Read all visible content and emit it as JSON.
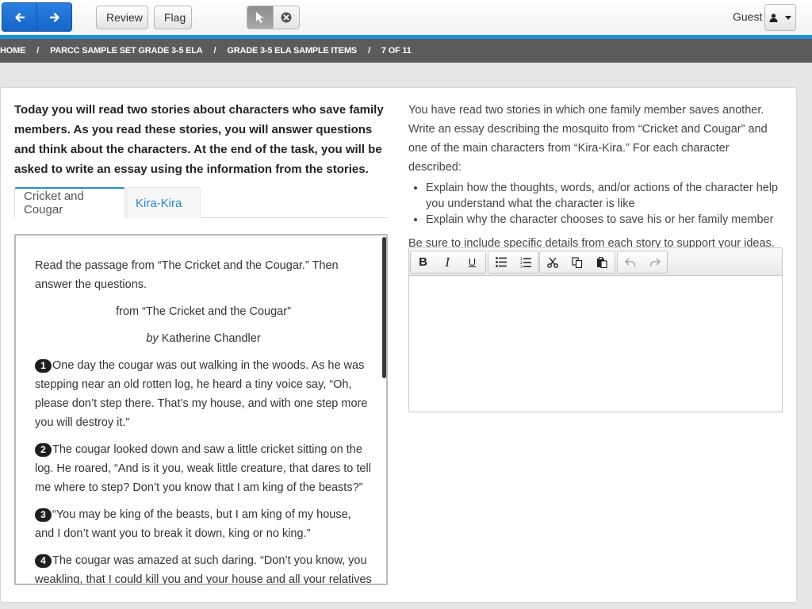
{
  "toolbar": {
    "back_icon": "arrow-left-icon",
    "forward_icon": "arrow-right-icon",
    "review_label": "Review",
    "flag_label": "Flag",
    "pointer_icon": "pointer-icon",
    "close_icon": "close-circle-icon",
    "user_label": "Guest",
    "accent_color": "#1f8ed6"
  },
  "breadcrumb": {
    "items": [
      "HOME",
      "PARCC SAMPLE SET GRADE 3-5 ELA",
      "GRADE 3-5 ELA SAMPLE ITEMS",
      "7 OF 11"
    ],
    "separator": "/"
  },
  "intro": "Today you will read two stories about characters who save family members. As you read these stories, you will answer questions and think about the characters. At the end of the task, you will be asked to write an essay using the information from the stories.",
  "tabs": [
    {
      "label": "Cricket and Cougar",
      "active": true
    },
    {
      "label": "Kira-Kira",
      "active": false
    }
  ],
  "passage": {
    "instruction": "Read the passage from “The Cricket and the Cougar.” Then answer the questions.",
    "title": "from “The Cricket and the Cougar”",
    "byline_prefix": "by",
    "author": "Katherine Chandler",
    "paragraphs": [
      {
        "num": "1",
        "text": "One day the cougar was out walking in the woods. As he was stepping near an old rotten log, he heard a tiny voice say, “Oh, please don’t step there. That’s my house, and with one step more you will destroy it.”"
      },
      {
        "num": "2",
        "text": "The cougar looked down and saw a little cricket sitting on the log. He roared, “And is it you, weak little creature, that dares to tell me where to step? Don’t you know that I am king of the beasts?”"
      },
      {
        "num": "3",
        "text": "“You may be king of the beasts, but I am king of my house, and I don’t want you to break it down, king or no king.”"
      },
      {
        "num": "4",
        "text": "The cougar was amazed at such daring. “Don’t you know, you weakling, that I could kill you and your house and all your relatives with"
      }
    ]
  },
  "prompt": {
    "text": "You have read two stories in which one family member saves another. Write an essay describing the mosquito from “Cricket and Cougar” and one of the main characters from “Kira-Kira.” For each character described:",
    "bullets": [
      "Explain how the thoughts, words, and/or actions of the character help you understand what the character is like",
      "Explain why the character chooses to save his or her family member"
    ],
    "closing": "Be sure to include specific details from each story to support your ideas."
  },
  "editor": {
    "value": "",
    "buttons": {
      "bold": "B",
      "italic": "I",
      "underline": "U"
    }
  }
}
